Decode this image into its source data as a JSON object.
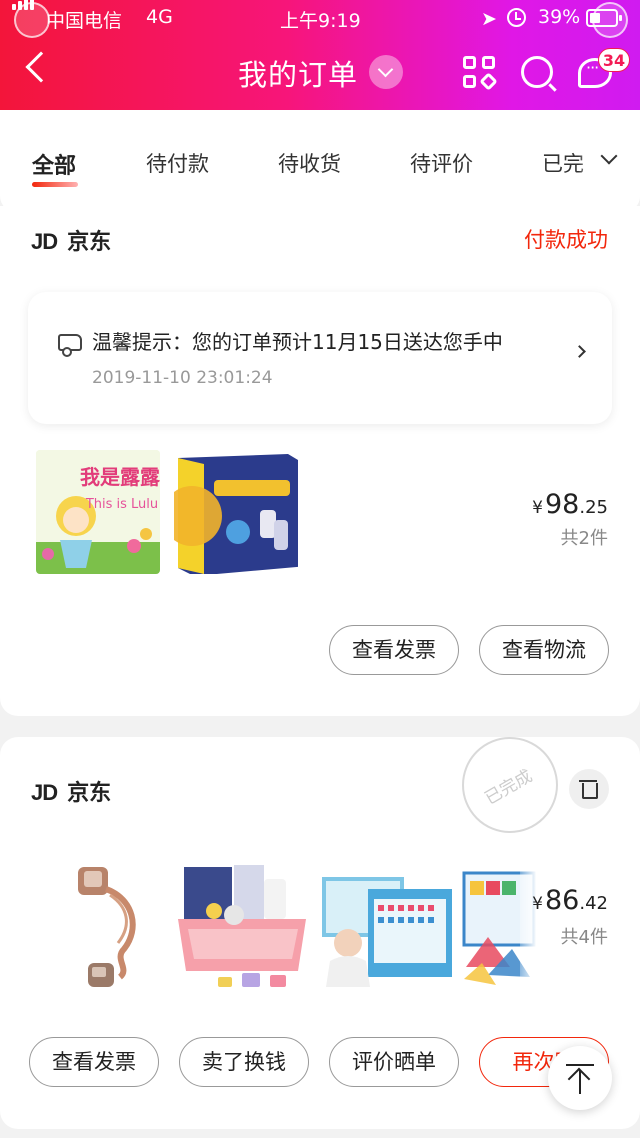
{
  "status_bar": {
    "carrier": "中国电信",
    "network": "4G",
    "time": "上午9:19",
    "battery": "39%"
  },
  "header": {
    "title": "我的订单",
    "message_count": "34"
  },
  "tabs": [
    "全部",
    "待付款",
    "待收货",
    "待评价",
    "已完"
  ],
  "orders": [
    {
      "shop": "京东",
      "shop_logo": "JD",
      "status": "付款成功",
      "notice": {
        "text": "温馨提示：您的订单预计11月15日送达您手中",
        "time": "2019-11-10 23:01:24"
      },
      "product_1_title": "我是露露",
      "product_1_subtitle": "This is Lulu",
      "price": {
        "currency": "¥",
        "integer": "98",
        "decimal": ".25"
      },
      "count": "共2件",
      "buttons": [
        "查看发票",
        "查看物流"
      ]
    },
    {
      "shop": "京东",
      "shop_logo": "JD",
      "stamp": "已完成",
      "price": {
        "currency": "¥",
        "integer": "86",
        "decimal": ".42"
      },
      "count": "共4件",
      "buttons": [
        "查看发票",
        "卖了换钱",
        "评价晒单",
        "再次购"
      ]
    }
  ],
  "colors": {
    "accent": "#f2270c",
    "header_start": "#f3153a",
    "header_end": "#d01bf0"
  }
}
